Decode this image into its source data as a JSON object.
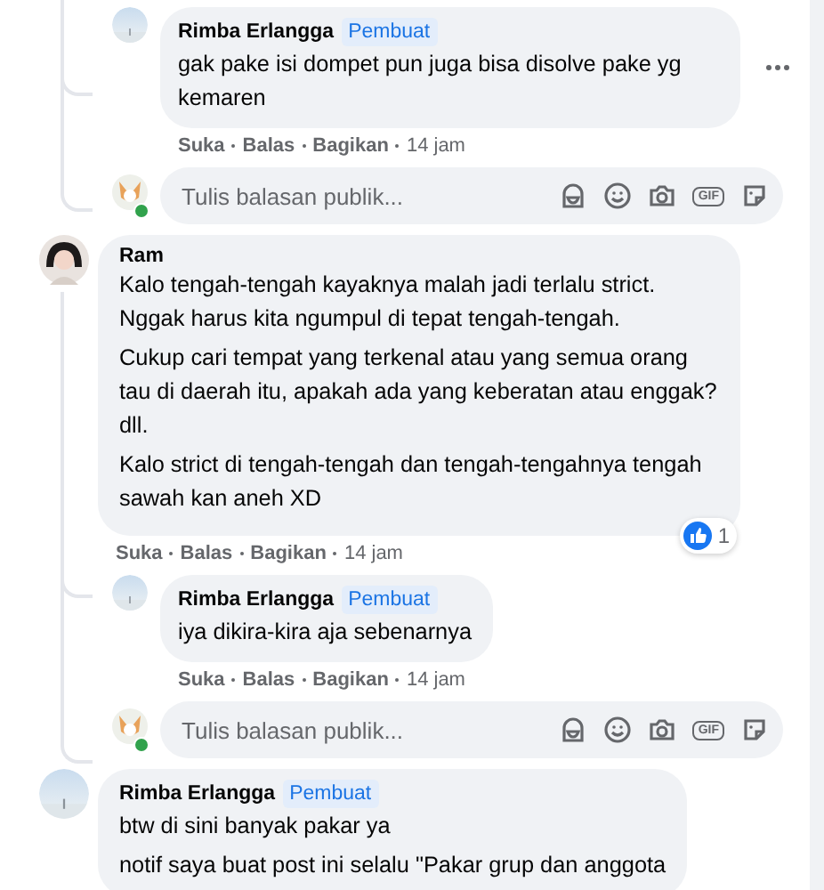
{
  "earlier_thread": {
    "replies": [
      {
        "author": "Rimba Erlangga",
        "badge": "Pembuat",
        "paragraphs": [
          "gak pake isi dompet pun juga bisa disolve pake yg kemaren"
        ],
        "actions": [
          "Suka",
          "Balas",
          "Bagikan"
        ],
        "time": "14 jam",
        "more_menu": true
      }
    ],
    "reply_box": {
      "placeholder": "Tulis balasan publik...",
      "online": true,
      "gif": "GIF"
    }
  },
  "comments": [
    {
      "author": "Ram",
      "paragraphs": [
        "Kalo tengah-tengah kayaknya malah jadi terlalu strict. Nggak harus kita ngumpul di tepat tengah-tengah.",
        "Cukup cari tempat yang terkenal atau yang semua orang tau di daerah itu, apakah ada yang keberatan atau enggak? dll.",
        "Kalo strict di tengah-tengah dan tengah-tengahnya tengah sawah kan aneh XD"
      ],
      "actions": [
        "Suka",
        "Balas",
        "Bagikan"
      ],
      "time": "14 jam",
      "reaction_count": "1",
      "replies": [
        {
          "author": "Rimba Erlangga",
          "badge": "Pembuat",
          "paragraphs": [
            "iya dikira-kira aja sebenarnya"
          ],
          "actions": [
            "Suka",
            "Balas",
            "Bagikan"
          ],
          "time": "14 jam"
        }
      ],
      "reply_box": {
        "placeholder": "Tulis balasan publik...",
        "online": true,
        "gif": "GIF"
      }
    },
    {
      "author": "Rimba Erlangga",
      "badge": "Pembuat",
      "paragraphs": [
        "btw di sini banyak pakar ya",
        "notif saya buat post ini selalu \"Pakar grup dan anggota"
      ]
    }
  ]
}
